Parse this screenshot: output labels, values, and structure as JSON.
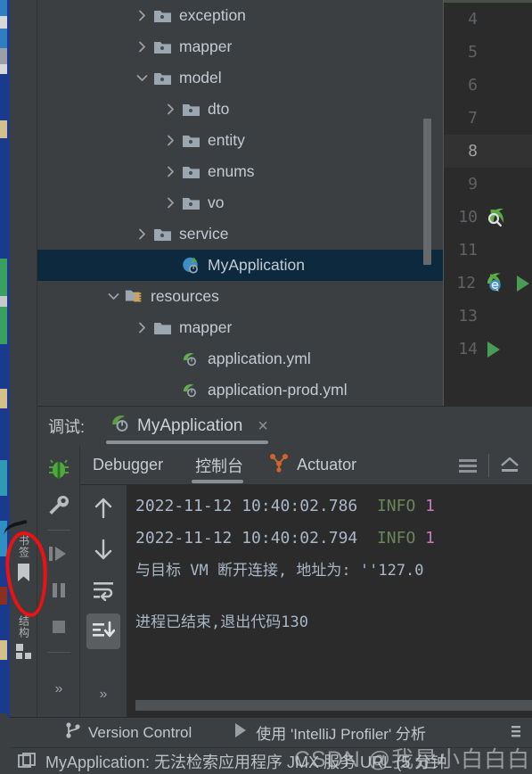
{
  "colors": {
    "accent_selection": "#0d293e",
    "console_bg": "#2b2b2b",
    "panel_bg": "#3c3f41",
    "info_green": "#6a8759",
    "pid_magenta": "#c77dbb",
    "annotation_red": "#ee1111",
    "spring_green": "#5a9e43",
    "run_green": "#499c54"
  },
  "left_tool_strip": {
    "tabs": [
      {
        "label": "书签",
        "icon": "bookmark-icon",
        "annotated": true
      },
      {
        "label": "结构",
        "icon": "structure-icon",
        "annotated": false
      }
    ]
  },
  "project_tree": {
    "rows": [
      {
        "indent": 3,
        "twisty": "chevron-right-icon",
        "icon": "folder-icon",
        "label": "exception",
        "selected": false
      },
      {
        "indent": 3,
        "twisty": "chevron-right-icon",
        "icon": "folder-icon",
        "label": "mapper",
        "selected": false
      },
      {
        "indent": 3,
        "twisty": "chevron-down-icon",
        "icon": "folder-icon",
        "label": "model",
        "selected": false
      },
      {
        "indent": 4,
        "twisty": "chevron-right-icon",
        "icon": "folder-icon",
        "label": "dto",
        "selected": false
      },
      {
        "indent": 4,
        "twisty": "chevron-right-icon",
        "icon": "folder-icon",
        "label": "entity",
        "selected": false
      },
      {
        "indent": 4,
        "twisty": "chevron-right-icon",
        "icon": "folder-icon",
        "label": "enums",
        "selected": false
      },
      {
        "indent": 4,
        "twisty": "chevron-right-icon",
        "icon": "folder-icon",
        "label": "vo",
        "selected": false
      },
      {
        "indent": 3,
        "twisty": "chevron-right-icon",
        "icon": "folder-icon",
        "label": "service",
        "selected": false
      },
      {
        "indent": 4,
        "twisty": "none",
        "icon": "spring-boot-class-icon",
        "label": "MyApplication",
        "selected": true
      },
      {
        "indent": 2,
        "twisty": "chevron-down-icon",
        "icon": "resources-folder-icon",
        "label": "resources",
        "selected": false
      },
      {
        "indent": 3,
        "twisty": "chevron-right-icon",
        "icon": "plain-folder-icon",
        "label": "mapper",
        "selected": false
      },
      {
        "indent": 4,
        "twisty": "none",
        "icon": "spring-yaml-icon",
        "label": "application.yml",
        "selected": false
      },
      {
        "indent": 4,
        "twisty": "none",
        "icon": "spring-yaml-icon",
        "label": "application-prod.yml",
        "selected": false
      }
    ]
  },
  "editor_gutter": {
    "lines": [
      {
        "num": "4",
        "current": false,
        "icon": "none"
      },
      {
        "num": "5",
        "current": false,
        "icon": "none"
      },
      {
        "num": "6",
        "current": false,
        "icon": "none"
      },
      {
        "num": "7",
        "current": false,
        "icon": "none"
      },
      {
        "num": "8",
        "current": true,
        "icon": "none"
      },
      {
        "num": "9",
        "current": false,
        "icon": "none"
      },
      {
        "num": "10",
        "current": false,
        "icon": "spring-bean-search-icon"
      },
      {
        "num": "11",
        "current": false,
        "icon": "none"
      },
      {
        "num": "12",
        "current": false,
        "icon": "spring-bean-icon,run-icon"
      },
      {
        "num": "13",
        "current": false,
        "icon": "none"
      },
      {
        "num": "14",
        "current": false,
        "icon": "run-icon"
      }
    ]
  },
  "debug_window": {
    "header_label": "调试:",
    "session_tab": {
      "label": "MyApplication",
      "icon": "spring-run-config-icon",
      "close": "×"
    },
    "side_buttons": [
      {
        "name": "debugger-bug-button",
        "icon": "bug-icon"
      },
      {
        "name": "settings-button",
        "icon": "wrench-icon"
      },
      {
        "name": "resume-button",
        "icon": "resume-icon"
      },
      {
        "name": "pause-button",
        "icon": "pause-icon"
      },
      {
        "name": "stop-button",
        "icon": "stop-icon"
      }
    ],
    "more_chevron": "»",
    "tabs": [
      {
        "label": "Debugger",
        "icon": "none",
        "active": false
      },
      {
        "label": "控制台",
        "icon": "none",
        "active": true
      },
      {
        "label": "Actuator",
        "icon": "actuator-icon",
        "active": false
      }
    ],
    "toolbar_icons": [
      {
        "name": "layout-menu-icon",
        "glyph": "hamburger-icon"
      },
      {
        "name": "export-icon",
        "glyph": "upload-icon"
      }
    ],
    "console_side_buttons": [
      {
        "name": "scroll-up-button",
        "icon": "arrow-up-icon",
        "active": false
      },
      {
        "name": "scroll-down-button",
        "icon": "arrow-down-icon",
        "active": false
      },
      {
        "name": "soft-wrap-button",
        "icon": "wrap-text-icon",
        "active": false
      },
      {
        "name": "scroll-to-end-button",
        "icon": "scroll-end-icon",
        "active": true
      }
    ],
    "console_more_chevron": "»",
    "console_lines": [
      {
        "type": "log",
        "time": "2022-11-12 10:40:02.786",
        "level": "INFO",
        "pid": "1"
      },
      {
        "type": "log",
        "time": "2022-11-12 10:40:02.794",
        "level": "INFO",
        "pid": "1"
      },
      {
        "type": "plain",
        "text": "与目标 VM 断开连接, 地址为: ''127.0"
      },
      {
        "type": "blank",
        "text": ""
      },
      {
        "type": "plain",
        "text": "进程已结束,退出代码130"
      }
    ]
  },
  "status_bar": {
    "version_control": {
      "label": "Version Control",
      "icon": "branch-icon"
    },
    "profiler": {
      "label": "使用 'IntelliJ Profiler' 分析",
      "icon": "run-triangle-icon"
    },
    "message": {
      "icon": "window-icon",
      "text": "MyApplication: 无法检索应用程序 JMX 服务 URL (5 分钟"
    }
  },
  "watermark": {
    "text": "CSDN @我是小白白白呀"
  }
}
